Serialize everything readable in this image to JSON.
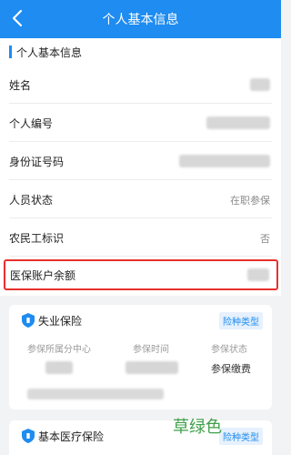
{
  "header": {
    "title": "个人基本信息"
  },
  "section": {
    "label": "个人基本信息"
  },
  "info_rows": [
    {
      "label": "姓名",
      "value": ""
    },
    {
      "label": "个人编号",
      "value": ""
    },
    {
      "label": "身份证号码",
      "value": ""
    },
    {
      "label": "人员状态",
      "value": "在职参保"
    },
    {
      "label": "农民工标识",
      "value": "否"
    },
    {
      "label": "医保账户余额",
      "value": ""
    }
  ],
  "cards": [
    {
      "title": "失业保险",
      "tag": "险种类型",
      "headers": [
        "参保所属分中心",
        "参保时间",
        "参保状态"
      ],
      "status": "参保缴费"
    },
    {
      "title": "基本医疗保险",
      "tag": "险种类型"
    }
  ],
  "watermark": "草绿色",
  "colors": {
    "primary": "#1e8cf0",
    "highlight_border": "#e8302d",
    "watermark": "#3fa04a"
  }
}
